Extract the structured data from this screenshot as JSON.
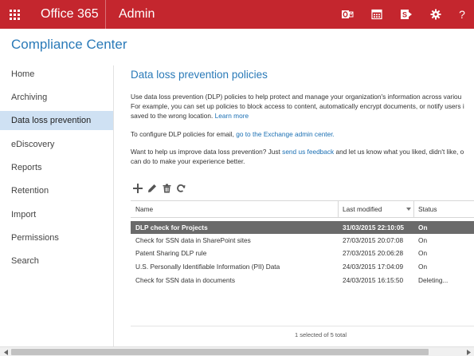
{
  "topbar": {
    "product": "Office 365",
    "section": "Admin",
    "bg_color": "#c4262e",
    "icons": [
      "outlook-icon",
      "calendar-icon",
      "sharepoint-icon",
      "settings-gear-icon",
      "help-icon"
    ]
  },
  "page_title": "Compliance Center",
  "sidebar": {
    "items": [
      {
        "label": "Home"
      },
      {
        "label": "Archiving"
      },
      {
        "label": "Data loss prevention",
        "active": true
      },
      {
        "label": "eDiscovery"
      },
      {
        "label": "Reports"
      },
      {
        "label": "Retention"
      },
      {
        "label": "Import"
      },
      {
        "label": "Permissions"
      },
      {
        "label": "Search"
      }
    ]
  },
  "main": {
    "title": "Data loss prevention policies",
    "intro_line1": "Use data loss prevention (DLP) policies to help protect and manage your organization's information across variou",
    "intro_line2": "For example, you can set up policies to block access to content, automatically encrypt documents, or notify users i",
    "intro_line3": "saved to the wrong location.",
    "learn_more": "Learn more",
    "email_prefix": "To configure DLP policies for email,",
    "email_link": "go to the Exchange admin center.",
    "feedback_prefix": "Want to help us improve data loss prevention? Just",
    "feedback_link": "send us feedback",
    "feedback_suffix": "and let us know what you liked, didn't like, o",
    "feedback_line2": "can do to make your experience better."
  },
  "toolbar": {
    "icons": [
      "add-icon",
      "edit-icon",
      "delete-icon",
      "refresh-icon"
    ]
  },
  "table": {
    "columns": [
      "Name",
      "Last modified",
      "Status"
    ],
    "rows": [
      {
        "name": "DLP check for Projects",
        "modified": "31/03/2015 22:10:05",
        "status": "On",
        "selected": true
      },
      {
        "name": "Check for SSN data in SharePoint sites",
        "modified": "27/03/2015 20:07:08",
        "status": "On"
      },
      {
        "name": "Patent Sharing DLP rule",
        "modified": "27/03/2015 20:06:28",
        "status": "On"
      },
      {
        "name": "U.S. Personally Identifiable Information (PII) Data",
        "modified": "24/03/2015 17:04:09",
        "status": "On"
      },
      {
        "name": "Check for SSN data in documents",
        "modified": "24/03/2015 16:15:50",
        "status": "Deleting..."
      }
    ],
    "footer": "1 selected of 5 total"
  },
  "colors": {
    "accent": "#2a7ab8",
    "nav_active": "#cfe1f3",
    "selected_row": "#6a6a6a"
  }
}
